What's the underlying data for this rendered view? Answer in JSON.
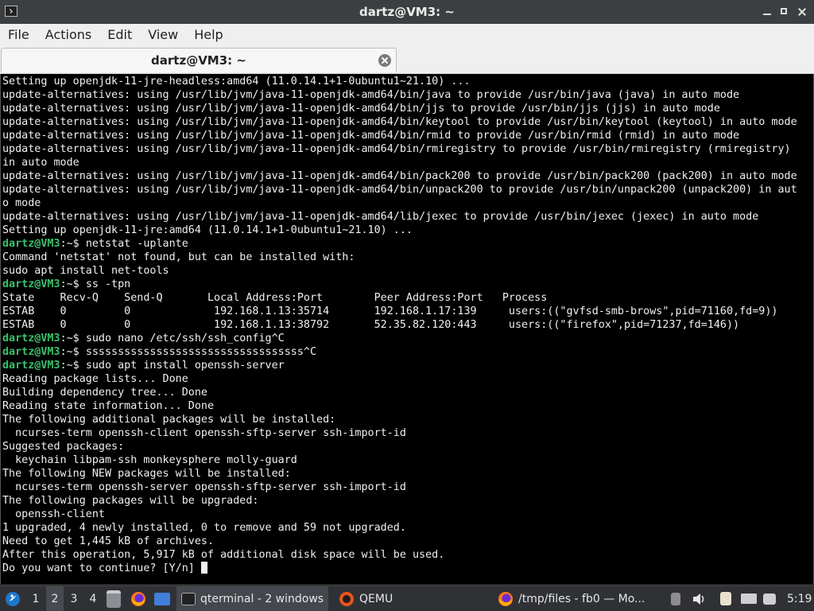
{
  "window": {
    "title": "dartz@VM3: ~"
  },
  "menu": [
    "File",
    "Actions",
    "Edit",
    "View",
    "Help"
  ],
  "tab": {
    "label": "dartz@VM3: ~"
  },
  "terminal": {
    "prompt": "dartz@VM3",
    "lines": [
      {
        "t": "Setting up openjdk-11-jre-headless:amd64 (11.0.14.1+1-0ubuntu1~21.10) ..."
      },
      {
        "t": "update-alternatives: using /usr/lib/jvm/java-11-openjdk-amd64/bin/java to provide /usr/bin/java (java) in auto mode"
      },
      {
        "t": "update-alternatives: using /usr/lib/jvm/java-11-openjdk-amd64/bin/jjs to provide /usr/bin/jjs (jjs) in auto mode"
      },
      {
        "t": "update-alternatives: using /usr/lib/jvm/java-11-openjdk-amd64/bin/keytool to provide /usr/bin/keytool (keytool) in auto mode"
      },
      {
        "t": "update-alternatives: using /usr/lib/jvm/java-11-openjdk-amd64/bin/rmid to provide /usr/bin/rmid (rmid) in auto mode"
      },
      {
        "t": "update-alternatives: using /usr/lib/jvm/java-11-openjdk-amd64/bin/rmiregistry to provide /usr/bin/rmiregistry (rmiregistry)"
      },
      {
        "t": "in auto mode"
      },
      {
        "t": "update-alternatives: using /usr/lib/jvm/java-11-openjdk-amd64/bin/pack200 to provide /usr/bin/pack200 (pack200) in auto mode"
      },
      {
        "t": "update-alternatives: using /usr/lib/jvm/java-11-openjdk-amd64/bin/unpack200 to provide /usr/bin/unpack200 (unpack200) in aut"
      },
      {
        "t": "o mode"
      },
      {
        "t": "update-alternatives: using /usr/lib/jvm/java-11-openjdk-amd64/lib/jexec to provide /usr/bin/jexec (jexec) in auto mode"
      },
      {
        "t": "Setting up openjdk-11-jre:amd64 (11.0.14.1+1-0ubuntu1~21.10) ..."
      },
      {
        "p": ":~$ ",
        "t": "netstat -uplante"
      },
      {
        "t": "Command 'netstat' not found, but can be installed with:"
      },
      {
        "t": "sudo apt install net-tools"
      },
      {
        "p": ":~$ ",
        "t": "ss -tpn"
      },
      {
        "t": "State    Recv-Q    Send-Q       Local Address:Port        Peer Address:Port   Process"
      },
      {
        "t": "ESTAB    0         0             192.168.1.13:35714       192.168.1.17:139     users:((\"gvfsd-smb-brows\",pid=71160,fd=9))"
      },
      {
        "t": "ESTAB    0         0             192.168.1.13:38792       52.35.82.120:443     users:((\"firefox\",pid=71237,fd=146))"
      },
      {
        "p": ":~$ ",
        "t": "sudo nano /etc/ssh/ssh_config^C"
      },
      {
        "p": ":~$ ",
        "t": "ssssssssssssssssssssssssssssssssss^C"
      },
      {
        "p": ":~$ ",
        "t": "sudo apt install openssh-server"
      },
      {
        "t": "Reading package lists... Done"
      },
      {
        "t": "Building dependency tree... Done"
      },
      {
        "t": "Reading state information... Done"
      },
      {
        "t": "The following additional packages will be installed:"
      },
      {
        "t": "  ncurses-term openssh-client openssh-sftp-server ssh-import-id"
      },
      {
        "t": "Suggested packages:"
      },
      {
        "t": "  keychain libpam-ssh monkeysphere molly-guard"
      },
      {
        "t": "The following NEW packages will be installed:"
      },
      {
        "t": "  ncurses-term openssh-server openssh-sftp-server ssh-import-id"
      },
      {
        "t": "The following packages will be upgraded:"
      },
      {
        "t": "  openssh-client"
      },
      {
        "t": "1 upgraded, 4 newly installed, 0 to remove and 59 not upgraded."
      },
      {
        "t": "Need to get 1,445 kB of archives."
      },
      {
        "t": "After this operation, 5,917 kB of additional disk space will be used."
      },
      {
        "t": "Do you want to continue? [Y/n] ",
        "cursor": true
      }
    ]
  },
  "taskbar": {
    "workspaces": [
      "1",
      "2",
      "3",
      "4"
    ],
    "active_workspace": "2",
    "tasks": {
      "qterminal": "qterminal - 2 windows",
      "qemu": "QEMU",
      "firefox": "/tmp/files - fb0 — Mo..."
    },
    "clock": "5:19"
  },
  "colors": {
    "terminal_bg": "#000000",
    "terminal_fg": "#f0f0f0",
    "prompt": "#39c16b",
    "titlebar_bg": "#3c3f41",
    "taskbar_bg": "#2f3135"
  }
}
